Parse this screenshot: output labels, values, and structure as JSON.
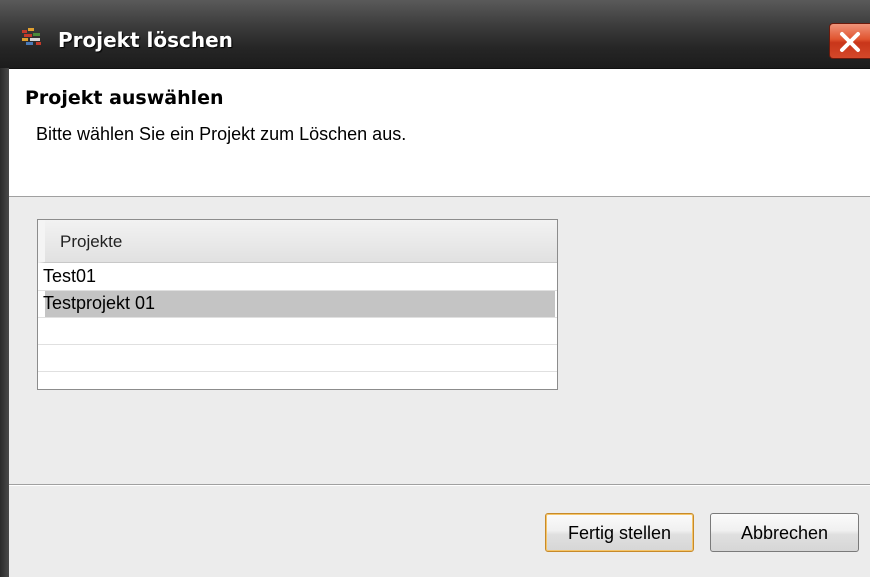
{
  "window": {
    "title": "Projekt löschen"
  },
  "header": {
    "title": "Projekt auswählen",
    "description": "Bitte wählen Sie ein Projekt zum Löschen aus."
  },
  "table": {
    "column_header": "Projekte",
    "rows": [
      {
        "label": "Test01",
        "selected": false
      },
      {
        "label": "Testprojekt 01",
        "selected": true
      },
      {
        "label": "",
        "selected": false
      },
      {
        "label": "",
        "selected": false
      },
      {
        "label": "",
        "selected": false
      }
    ]
  },
  "buttons": {
    "finish_label": "Fertig stellen",
    "cancel_label": "Abbrechen"
  },
  "icons": {
    "app": "app-icon",
    "close": "close-icon"
  },
  "colors": {
    "close_button": "#d4482a",
    "selection": "#c4c4c4",
    "titlebar": "#262626"
  }
}
